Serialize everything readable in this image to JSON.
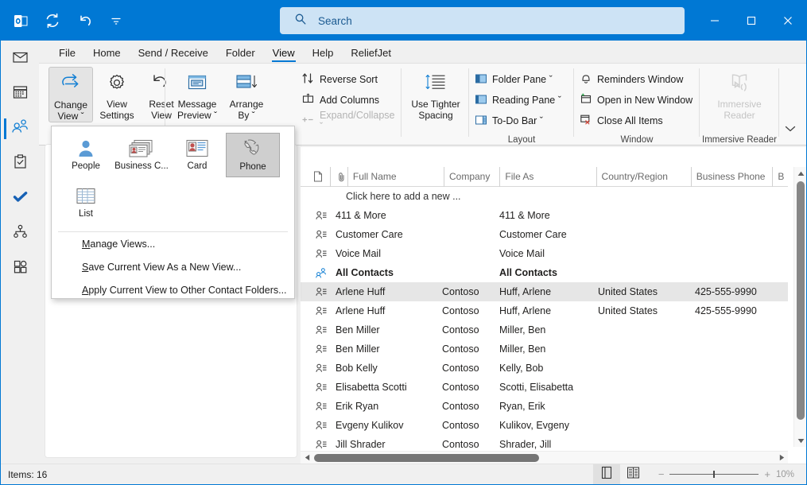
{
  "titlebar": {
    "qat": [
      {
        "name": "outlook-logo-icon",
        "label": "Outlook"
      },
      {
        "name": "send-receive-icon",
        "label": "Send/Receive All Folders"
      },
      {
        "name": "undo-icon",
        "label": "Undo"
      },
      {
        "name": "customize-qat-icon",
        "label": "Customize Quick Access Toolbar"
      }
    ],
    "search": {
      "placeholder": "Search",
      "value": "",
      "icon": "search-icon"
    },
    "window": {
      "minimize": "—",
      "maximize": "❑",
      "close": "✕"
    }
  },
  "navrail": {
    "items": [
      {
        "name": "mail",
        "label": "Mail",
        "selected": false
      },
      {
        "name": "calendar",
        "label": "Calendar",
        "selected": false
      },
      {
        "name": "people",
        "label": "People",
        "selected": true
      },
      {
        "name": "tasks",
        "label": "Tasks",
        "selected": false
      },
      {
        "name": "todo",
        "label": "To Do",
        "selected": false
      },
      {
        "name": "groups",
        "label": "Groups",
        "selected": false
      },
      {
        "name": "more-apps",
        "label": "More Apps",
        "selected": false
      }
    ]
  },
  "ribbon": {
    "tabs": [
      {
        "label": "File",
        "active": false
      },
      {
        "label": "Home",
        "active": false
      },
      {
        "label": "Send / Receive",
        "active": false
      },
      {
        "label": "Folder",
        "active": false
      },
      {
        "label": "View",
        "active": true
      },
      {
        "label": "Help",
        "active": false
      },
      {
        "label": "ReliefJet",
        "active": false
      }
    ],
    "current_view_group": {
      "buttons": [
        {
          "label_line1": "Change",
          "label_line2": "View ˇ",
          "icon": "change-view-icon",
          "pressed": true
        },
        {
          "label_line1": "View",
          "label_line2": "Settings",
          "icon": "view-settings-gear-icon",
          "pressed": false
        },
        {
          "label_line1": "Reset",
          "label_line2": "View",
          "icon": "reset-view-icon",
          "pressed": false
        }
      ]
    },
    "arrangement_group": {
      "buttons": [
        {
          "label_line1": "Message",
          "label_line2": "Preview ˇ",
          "icon": "message-preview-icon"
        },
        {
          "label_line1": "Arrange",
          "label_line2": "By ˇ",
          "icon": "arrange-by-icon"
        }
      ],
      "commands": [
        {
          "label": "Reverse Sort",
          "icon": "reverse-sort-icon",
          "disabled": false
        },
        {
          "label": "Add Columns",
          "icon": "add-columns-icon",
          "disabled": false
        },
        {
          "label": "Expand/Collapse ˇ",
          "icon": "expand-collapse-icon",
          "disabled": true
        }
      ]
    },
    "spacing_group": {
      "button": {
        "label_line1": "Use Tighter",
        "label_line2": "Spacing",
        "icon": "tighter-spacing-icon"
      }
    },
    "layout_group": {
      "label": "Layout",
      "commands": [
        {
          "label": "Folder Pane ˇ",
          "icon": "folder-pane-icon"
        },
        {
          "label": "Reading Pane ˇ",
          "icon": "reading-pane-icon"
        },
        {
          "label": "To-Do Bar ˇ",
          "icon": "todo-bar-icon"
        }
      ]
    },
    "window_group": {
      "label": "Window",
      "commands": [
        {
          "label": "Reminders Window",
          "icon": "bell-icon"
        },
        {
          "label": "Open in New Window",
          "icon": "new-window-icon"
        },
        {
          "label": "Close All Items",
          "icon": "close-all-items-icon"
        }
      ]
    },
    "immersive_group": {
      "label": "Immersive Reader",
      "button": {
        "label_line1": "Immersive",
        "label_line2": "Reader",
        "icon": "immersive-reader-icon",
        "disabled": true
      }
    },
    "collapse_icon": "chevron-down-icon"
  },
  "change_view_menu": {
    "gallery": [
      {
        "label": "People",
        "icon": "people-view-icon",
        "selected": false
      },
      {
        "label": "Business C...",
        "icon": "business-card-view-icon",
        "selected": false
      },
      {
        "label": "Card",
        "icon": "card-view-icon",
        "selected": false
      },
      {
        "label": "Phone",
        "icon": "phone-view-icon",
        "selected": true
      },
      {
        "label": "List",
        "icon": "list-view-icon",
        "selected": false
      }
    ],
    "commands": [
      {
        "accel": "M",
        "rest": "anage Views..."
      },
      {
        "accel": "S",
        "rest": "ave Current View As a New View..."
      },
      {
        "accel": "A",
        "rest": "pply Current View to Other Contact Folders..."
      }
    ]
  },
  "contact_list": {
    "columns": [
      {
        "label": "",
        "name": "icon-column",
        "width": 38
      },
      {
        "label": "",
        "name": "attachment-column",
        "width": 22
      },
      {
        "label": "Full Name",
        "name": "full-name",
        "width": 124
      },
      {
        "label": "Company",
        "name": "company",
        "width": 72
      },
      {
        "label": "File As",
        "name": "file-as",
        "width": 124
      },
      {
        "label": "Country/Region",
        "name": "country-region",
        "width": 122
      },
      {
        "label": "Business Phone",
        "name": "business-phone",
        "width": 105
      },
      {
        "label": "B",
        "name": "business-phone-2",
        "width": 20
      }
    ],
    "add_new_row": "Click here to add a new ...",
    "rows": [
      {
        "icon": "contact-icon",
        "full_name": "411 & More",
        "company": "",
        "file_as": "411 & More",
        "country": "",
        "phone": "",
        "selected": false,
        "bold": false
      },
      {
        "icon": "contact-icon",
        "full_name": "Customer Care",
        "company": "",
        "file_as": "Customer Care",
        "country": "",
        "phone": "",
        "selected": false,
        "bold": false
      },
      {
        "icon": "contact-icon",
        "full_name": "Voice Mail",
        "company": "",
        "file_as": "Voice Mail",
        "country": "",
        "phone": "",
        "selected": false,
        "bold": false
      },
      {
        "icon": "contact-group-icon",
        "full_name": "All Contacts",
        "company": "",
        "file_as": "All Contacts",
        "country": "",
        "phone": "",
        "selected": false,
        "bold": true
      },
      {
        "icon": "contact-icon",
        "full_name": "Arlene Huff",
        "company": "Contoso",
        "file_as": "Huff, Arlene",
        "country": "United States",
        "phone": "425-555-9990",
        "selected": true,
        "bold": false
      },
      {
        "icon": "contact-icon",
        "full_name": "Arlene Huff",
        "company": "Contoso",
        "file_as": "Huff, Arlene",
        "country": "United States",
        "phone": "425-555-9990",
        "selected": false,
        "bold": false
      },
      {
        "icon": "contact-icon",
        "full_name": "Ben Miller",
        "company": "Contoso",
        "file_as": "Miller, Ben",
        "country": "",
        "phone": "",
        "selected": false,
        "bold": false
      },
      {
        "icon": "contact-icon",
        "full_name": "Ben Miller",
        "company": "Contoso",
        "file_as": "Miller, Ben",
        "country": "",
        "phone": "",
        "selected": false,
        "bold": false
      },
      {
        "icon": "contact-icon",
        "full_name": "Bob Kelly",
        "company": "Contoso",
        "file_as": "Kelly, Bob",
        "country": "",
        "phone": "",
        "selected": false,
        "bold": false
      },
      {
        "icon": "contact-icon",
        "full_name": "Elisabetta Scotti",
        "company": "Contoso",
        "file_as": "Scotti, Elisabetta",
        "country": "",
        "phone": "",
        "selected": false,
        "bold": false
      },
      {
        "icon": "contact-icon",
        "full_name": "Erik Ryan",
        "company": "Contoso",
        "file_as": "Ryan, Erik",
        "country": "",
        "phone": "",
        "selected": false,
        "bold": false
      },
      {
        "icon": "contact-icon",
        "full_name": "Evgeny Kulikov",
        "company": "Contoso",
        "file_as": "Kulikov, Evgeny",
        "country": "",
        "phone": "",
        "selected": false,
        "bold": false
      },
      {
        "icon": "contact-icon",
        "full_name": "Jill Shrader",
        "company": "Contoso",
        "file_as": "Shrader, Jill",
        "country": "",
        "phone": "",
        "selected": false,
        "bold": false
      }
    ]
  },
  "statusbar": {
    "items_text": "Items: 16",
    "view_buttons": [
      {
        "name": "normal-view-button",
        "icon": "normal-view-icon",
        "active": true
      },
      {
        "name": "reading-view-button",
        "icon": "reading-view-icon",
        "active": false
      }
    ],
    "zoom": {
      "minus": "−",
      "plus": "+",
      "percent": "10%"
    }
  },
  "colors": {
    "accent": "#0078d4",
    "titlebar": "#0078d4",
    "search_bg": "#cde3f5",
    "ribbon_bg": "#f8f8f8",
    "chrome_bg": "#f0f0f0",
    "selection": "#e6e6e6"
  }
}
